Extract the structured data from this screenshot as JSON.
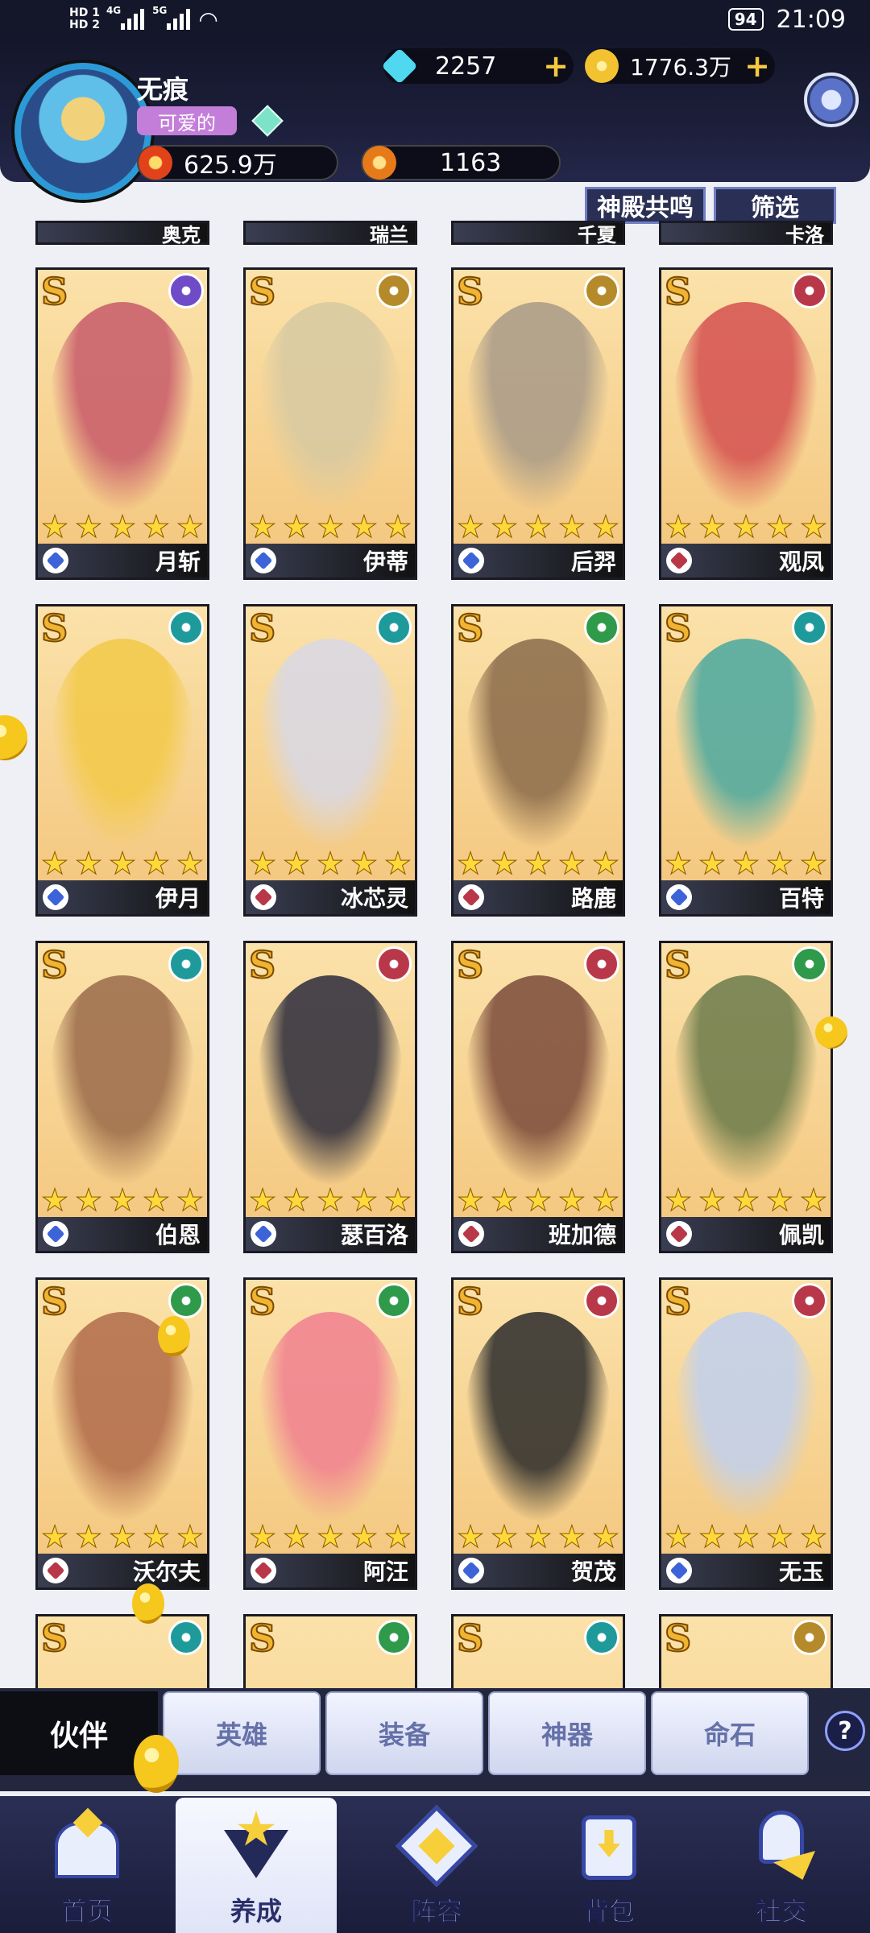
{
  "status_bar": {
    "network": [
      "HD 1",
      "HD 2"
    ],
    "signal": [
      "4G",
      "5G"
    ],
    "battery": "94",
    "time": "21:09"
  },
  "profile": {
    "name": "无痕",
    "title": "可爱的",
    "diamonds": "2257",
    "gold": "1776.3万",
    "power": "625.9万",
    "energy": "1163"
  },
  "filters": {
    "resonance": "神殿共鸣",
    "filter": "筛选"
  },
  "top_row_names": [
    "奥克",
    "瑞兰",
    "千夏",
    "卡洛"
  ],
  "cards": [
    {
      "name": "月斩",
      "rank": "S",
      "stars": 5,
      "faction": "purple",
      "class": "blue"
    },
    {
      "name": "伊蒂",
      "rank": "S",
      "stars": 5,
      "faction": "gold",
      "class": "blue"
    },
    {
      "name": "后羿",
      "rank": "S",
      "stars": 5,
      "faction": "gold",
      "class": "blue"
    },
    {
      "name": "观凤",
      "rank": "S",
      "stars": 5,
      "faction": "red",
      "class": "red"
    },
    {
      "name": "伊月",
      "rank": "S",
      "stars": 5,
      "faction": "teal",
      "class": "blue"
    },
    {
      "name": "冰芯灵",
      "rank": "S",
      "stars": 5,
      "faction": "teal",
      "class": "red"
    },
    {
      "name": "路鹿",
      "rank": "S",
      "stars": 5,
      "faction": "green",
      "class": "red"
    },
    {
      "name": "百特",
      "rank": "S",
      "stars": 5,
      "faction": "teal",
      "class": "blue"
    },
    {
      "name": "伯恩",
      "rank": "S",
      "stars": 5,
      "faction": "teal",
      "class": "blue"
    },
    {
      "name": "瑟百洛",
      "rank": "S",
      "stars": 5,
      "faction": "red",
      "class": "blue"
    },
    {
      "name": "班加德",
      "rank": "S",
      "stars": 5,
      "faction": "red",
      "class": "red"
    },
    {
      "name": "佩凯",
      "rank": "S",
      "stars": 5,
      "faction": "green",
      "class": "red"
    },
    {
      "name": "沃尔夫",
      "rank": "S",
      "stars": 5,
      "faction": "green",
      "class": "red"
    },
    {
      "name": "阿汪",
      "rank": "S",
      "stars": 5,
      "faction": "green",
      "class": "red"
    },
    {
      "name": "贺茂",
      "rank": "S",
      "stars": 5,
      "faction": "red",
      "class": "blue"
    },
    {
      "name": "无玉",
      "rank": "S",
      "stars": 5,
      "faction": "red",
      "class": "blue"
    }
  ],
  "bottom_row": [
    {
      "rank": "S",
      "faction": "teal"
    },
    {
      "rank": "S",
      "faction": "green"
    },
    {
      "rank": "S",
      "faction": "teal"
    },
    {
      "rank": "S",
      "faction": "gold"
    }
  ],
  "subtabs": [
    "伙伴",
    "英雄",
    "装备",
    "神器",
    "命石"
  ],
  "help": "?",
  "nav": [
    "首页",
    "养成",
    "阵容",
    "背包",
    "社交"
  ],
  "colors": {
    "purple": "#6f4bc8",
    "gold": "#b58a2a",
    "red": "#b8384a",
    "teal": "#1f9a9a",
    "green": "#2f9a4a",
    "blue": "#3d63d8"
  }
}
